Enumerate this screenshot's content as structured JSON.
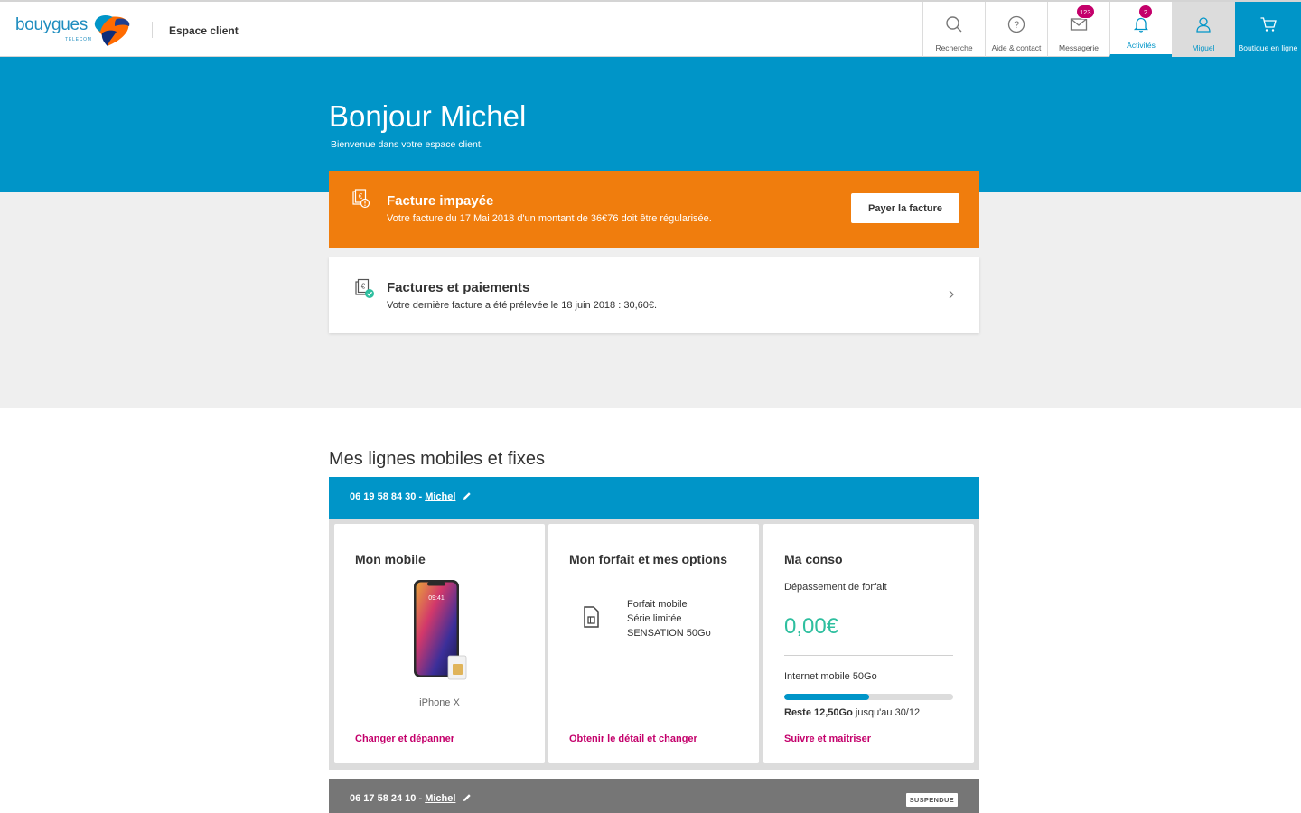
{
  "header": {
    "logo_text": "bouygues",
    "logo_sub": "TELECOM",
    "section_title": "Espace client",
    "nav": [
      {
        "label": "Recherche",
        "icon": "search-icon"
      },
      {
        "label": "Aide & contact",
        "icon": "help-icon"
      },
      {
        "label": "Messagerie",
        "icon": "mail-icon",
        "badge": "123"
      },
      {
        "label": "Activités",
        "icon": "bell-icon",
        "badge": "2"
      },
      {
        "label": "Miguel",
        "icon": "user-icon"
      },
      {
        "label": "Boutique en ligne",
        "icon": "cart-icon"
      }
    ]
  },
  "hero": {
    "greeting": "Bonjour Michel",
    "subtitle": "Bienvenue dans votre espace client."
  },
  "unpaid": {
    "title": "Facture impayée",
    "text": "Votre facture du 17 Mai 2018 d'un montant de 36€76 doit être régularisée.",
    "button": "Payer la facture"
  },
  "bills": {
    "title": "Factures et paiements",
    "text": "Votre dernière facture a été prélevée le 18 juin 2018 : 30,60€."
  },
  "lines_section": {
    "title": "Mes lignes mobiles et fixes",
    "line1": {
      "number": "06 19 58 84 30 - ",
      "user": "Michel",
      "mobile": {
        "title": "Mon mobile",
        "phone_name": "iPhone X",
        "phone_time": "09:41",
        "link": "Changer et dépanner"
      },
      "plan": {
        "title": "Mon forfait et mes options",
        "line1": "Forfait mobile",
        "line2": "Série limitée",
        "line3": "SENSATION 50Go",
        "link": "Obtenir le détail et changer"
      },
      "conso": {
        "title": "Ma conso",
        "sub": "Dépassement de forfait",
        "value": "0,00€",
        "data_label": "Internet mobile 50Go",
        "data_used_fraction": 0.5,
        "remain_bold": "Reste 12,50Go",
        "remain_text": " jusqu'au 30/12",
        "link": "Suivre et maitriser"
      }
    },
    "line2": {
      "number": "06 17 58 24 10 - ",
      "user": "Michel",
      "status": "SUSPENDUE"
    }
  },
  "colors": {
    "brand_blue": "#0095c8",
    "orange": "#f07d0d",
    "magenta": "#c4006b",
    "green": "#2ebf9f"
  }
}
